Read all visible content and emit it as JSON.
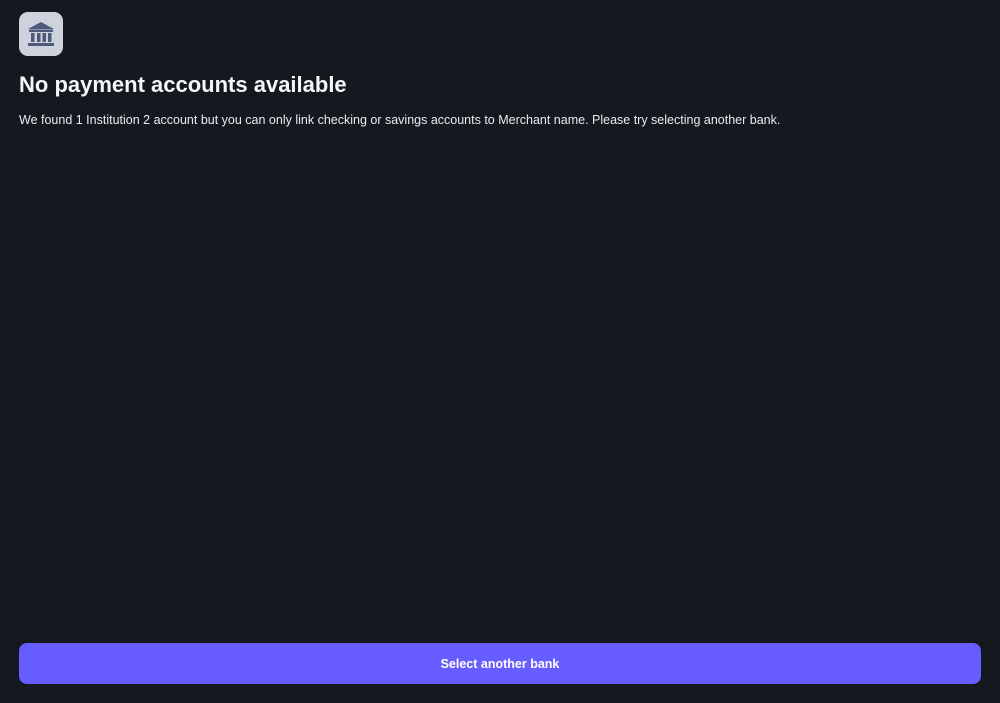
{
  "icon": {
    "name": "bank-icon",
    "background_color": "#cdd2dc",
    "glyph_color": "#4d5a7c"
  },
  "title": "No payment accounts available",
  "message": "We found 1 Institution 2 account but you can only link checking or savings accounts to Merchant name. Please try selecting another bank.",
  "actions": {
    "primary_label": "Select another bank",
    "primary_color": "#675dff"
  },
  "colors": {
    "background": "#161820",
    "text": "#f2f3f6"
  }
}
